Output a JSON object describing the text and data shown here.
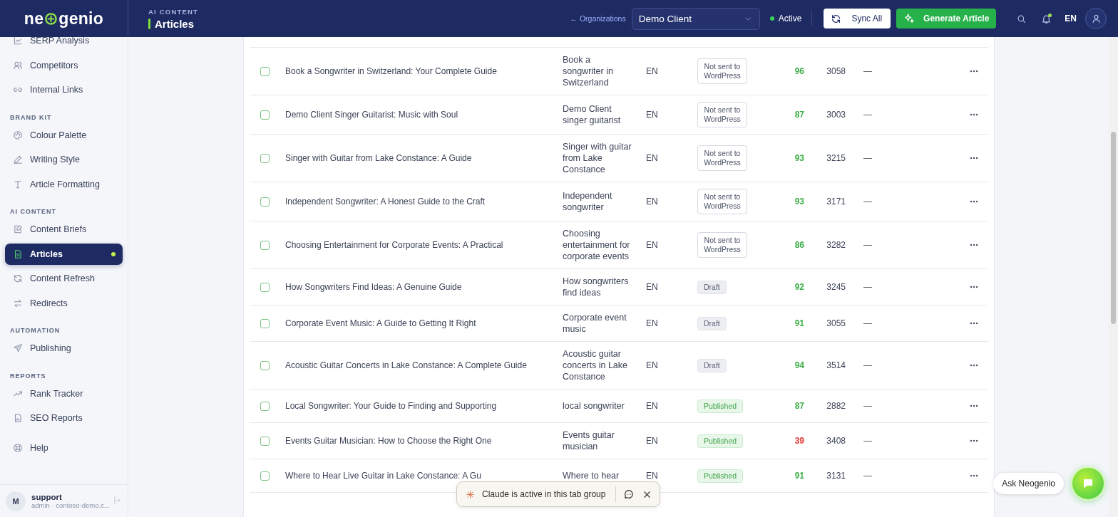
{
  "header": {
    "logo": {
      "before": "ne",
      "after": "genio"
    },
    "section": "AI CONTENT",
    "title": "Articles",
    "org_link": "← Organizations",
    "client_select": "Demo Client",
    "status": "Active",
    "sync_button": "Sync All",
    "generate_button": "Generate Article",
    "notifications_unread": true,
    "language": "EN"
  },
  "sidebar": {
    "groups": [
      {
        "items": [
          {
            "label": "SERP Analysis",
            "selected": false
          },
          {
            "label": "Competitors",
            "selected": false
          },
          {
            "label": "Internal Links",
            "selected": false
          }
        ]
      },
      {
        "label": "BRAND KIT",
        "items": [
          {
            "label": "Colour Palette",
            "selected": false
          },
          {
            "label": "Writing Style",
            "selected": false
          },
          {
            "label": "Article Formatting",
            "selected": false
          }
        ]
      },
      {
        "label": "AI CONTENT",
        "items": [
          {
            "label": "Content Briefs",
            "selected": false
          },
          {
            "label": "Articles",
            "selected": true
          },
          {
            "label": "Content Refresh",
            "selected": false
          },
          {
            "label": "Redirects",
            "selected": false
          }
        ]
      },
      {
        "label": "AUTOMATION",
        "items": [
          {
            "label": "Publishing",
            "selected": false
          }
        ]
      },
      {
        "label": "REPORTS",
        "items": [
          {
            "label": "Rank Tracker",
            "selected": false
          },
          {
            "label": "SEO Reports",
            "selected": false
          }
        ]
      },
      {
        "items": [
          {
            "label": "Help",
            "selected": false
          }
        ]
      }
    ],
    "user": {
      "initial": "M",
      "name": "support",
      "detail": "admin · contoso-demo.c..."
    }
  },
  "table": {
    "rows": [
      {
        "checked": false,
        "title": "Book a Songwriter in Switzerland: Your Complete Guide",
        "keyword": "Book a songwriter in Switzerland",
        "language": "EN",
        "status": {
          "kind": "not_sent",
          "text": "Not sent to WordPress"
        },
        "score": {
          "text": "96",
          "color": "#3fae49"
        },
        "words": "3058",
        "column_7": "—"
      },
      {
        "checked": false,
        "title": "Demo Client Singer Guitarist: Music with Soul",
        "keyword": "Demo Client singer guitarist",
        "language": "EN",
        "status": {
          "kind": "not_sent",
          "text": "Not sent to WordPress"
        },
        "score": {
          "text": "87",
          "color": "#3fae49"
        },
        "words": "3003",
        "column_7": "—"
      },
      {
        "checked": false,
        "title": "Singer with Guitar from Lake Constance: A Guide",
        "keyword": "Singer with guitar from Lake Constance",
        "language": "EN",
        "status": {
          "kind": "not_sent",
          "text": "Not sent to WordPress"
        },
        "score": {
          "text": "93",
          "color": "#3fae49"
        },
        "words": "3215",
        "column_7": "—"
      },
      {
        "checked": false,
        "title": "Independent Songwriter: A Honest Guide to the Craft",
        "keyword": "Independent songwriter",
        "language": "EN",
        "status": {
          "kind": "not_sent",
          "text": "Not sent to WordPress"
        },
        "score": {
          "text": "93",
          "color": "#3fae49"
        },
        "words": "3171",
        "column_7": "—"
      },
      {
        "checked": false,
        "title": "Choosing Entertainment for Corporate Events: A Practical",
        "keyword": "Choosing entertainment for corporate events",
        "language": "EN",
        "status": {
          "kind": "not_sent",
          "text": "Not sent to WordPress"
        },
        "score": {
          "text": "86",
          "color": "#3fae49"
        },
        "words": "3282",
        "column_7": "—"
      },
      {
        "checked": false,
        "title": "How Songwriters Find Ideas: A Genuine Guide",
        "keyword": "How songwriters find ideas",
        "language": "EN",
        "status": {
          "kind": "draft",
          "text": "Draft"
        },
        "score": {
          "text": "92",
          "color": "#3fae49"
        },
        "words": "3245",
        "column_7": "—"
      },
      {
        "checked": false,
        "title": "Corporate Event Music: A Guide to Getting It Right",
        "keyword": "Corporate event music",
        "language": "EN",
        "status": {
          "kind": "draft",
          "text": "Draft"
        },
        "score": {
          "text": "91",
          "color": "#3fae49"
        },
        "words": "3055",
        "column_7": "—"
      },
      {
        "checked": false,
        "title": "Acoustic Guitar Concerts in Lake Constance: A Complete Guide",
        "keyword": "Acoustic guitar concerts in Lake Constance",
        "language": "EN",
        "status": {
          "kind": "draft",
          "text": "Draft"
        },
        "score": {
          "text": "94",
          "color": "#3fae49"
        },
        "words": "3514",
        "column_7": "—"
      },
      {
        "checked": false,
        "title": "Local Songwriter: Your Guide to Finding and Supporting",
        "keyword": "local songwriter",
        "language": "EN",
        "status": {
          "kind": "published",
          "text": "Published"
        },
        "score": {
          "text": "87",
          "color": "#3fae49"
        },
        "words": "2882",
        "column_7": "—"
      },
      {
        "checked": false,
        "title": "Events Guitar Musician: How to Choose the Right One",
        "keyword": "Events guitar musician",
        "language": "EN",
        "status": {
          "kind": "published",
          "text": "Published"
        },
        "score": {
          "text": "39",
          "color": "#e53935"
        },
        "words": "3408",
        "column_7": "—"
      },
      {
        "checked": false,
        "title": "Where to Hear Live Guitar in Lake Constance: A Gu",
        "keyword": "Where to hear",
        "language": "EN",
        "status": {
          "kind": "published",
          "text": "Published"
        },
        "score": {
          "text": "91",
          "color": "#3fae49"
        },
        "words": "3131",
        "column_7": "—"
      }
    ]
  },
  "toast": {
    "text": "Claude is active in this tab group"
  },
  "assistant": {
    "label": "Ask Neogenio"
  }
}
